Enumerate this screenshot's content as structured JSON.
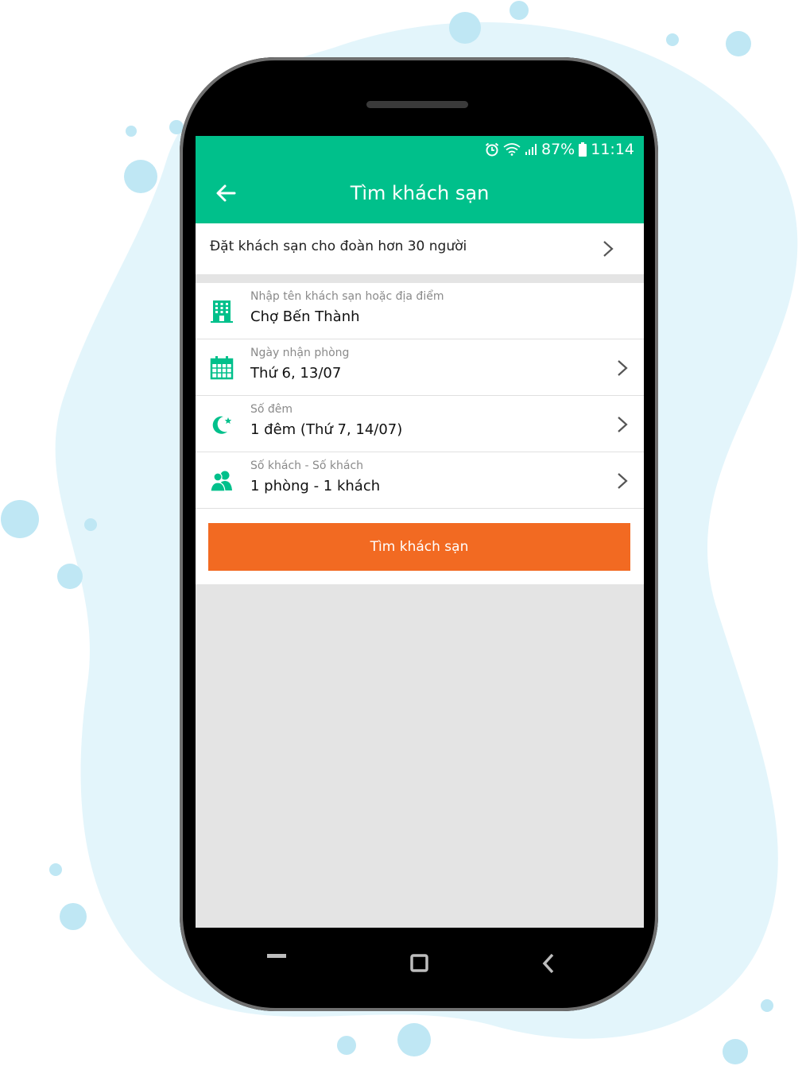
{
  "status_bar": {
    "battery": "87%",
    "time": "11:14",
    "icons": [
      "alarm-icon",
      "wifi-icon",
      "signal-icon",
      "battery-icon"
    ]
  },
  "app_bar": {
    "title": "Tìm khách sạn",
    "back_icon": "arrow-left-icon"
  },
  "group_booking": {
    "label": "Đặt khách sạn cho đoàn hơn 30 người"
  },
  "fields": [
    {
      "icon": "hotel-building-icon",
      "label": "Nhập tên khách sạn hoặc địa điểm",
      "value": "Chợ Bến Thành",
      "has_chevron": false
    },
    {
      "icon": "calendar-icon",
      "label": "Ngày nhận phòng",
      "value": "Thứ 6, 13/07",
      "has_chevron": true
    },
    {
      "icon": "moon-star-icon",
      "label": "Số đêm",
      "value": "1 đêm (Thứ 7, 14/07)",
      "has_chevron": true
    },
    {
      "icon": "people-icon",
      "label": "Số khách - Số khách",
      "value": "1 phòng - 1 khách",
      "has_chevron": true
    }
  ],
  "search_button": {
    "label": "Tìm khách sạn"
  },
  "nav_bar": {
    "icons": [
      "recent-apps-icon",
      "home-icon",
      "back-icon"
    ]
  },
  "colors": {
    "primary": "#00c08b",
    "accent": "#f26a22",
    "background_blob": "#e3f5fb",
    "dots": "#bfe7f4"
  }
}
